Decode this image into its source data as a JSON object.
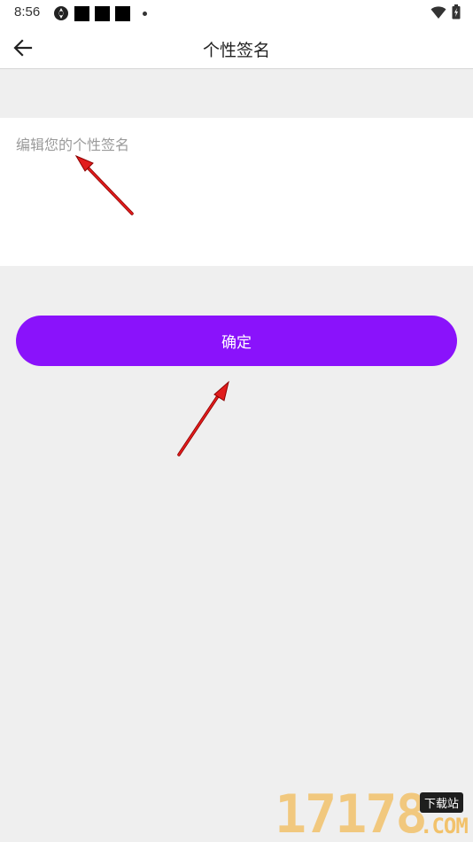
{
  "status_bar": {
    "time": "8:56"
  },
  "header": {
    "title": "个性签名",
    "back_icon": "arrow-left-icon"
  },
  "signature": {
    "placeholder": "编辑您的个性签名",
    "value": ""
  },
  "confirm_button": {
    "label": "确定",
    "color": "#8a12fb"
  },
  "colors": {
    "background": "#efefef",
    "annotation_arrow": "#e11c1c"
  },
  "watermark": {
    "digits": "17178",
    "badge": "下载站",
    "domain": ".COM"
  }
}
